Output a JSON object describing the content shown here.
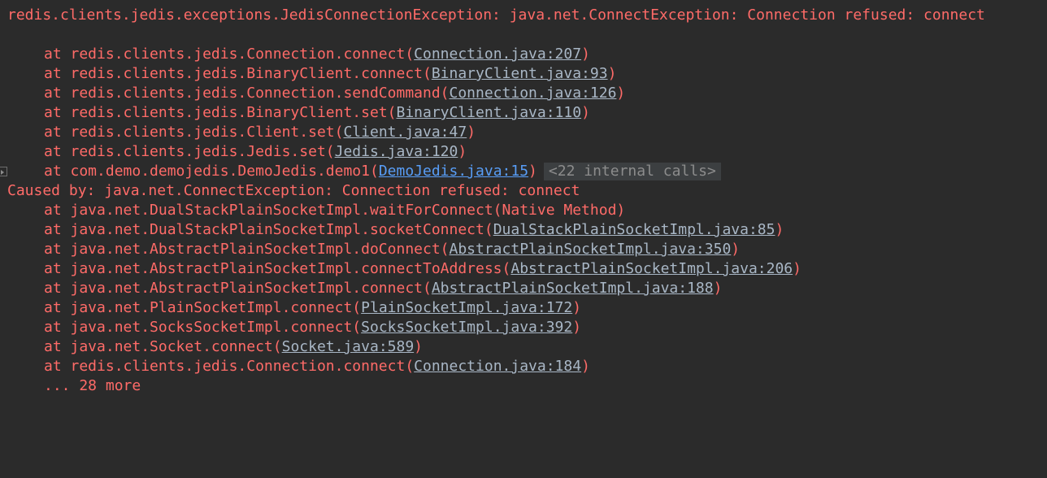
{
  "console": {
    "header": "redis.clients.jedis.exceptions.JedisConnectionException: java.net.ConnectException: Connection refused: connect",
    "frames1": [
      {
        "prefix": "at redis.clients.jedis.Connection.connect(",
        "link": "Connection.java:207",
        "suffix": ")"
      },
      {
        "prefix": "at redis.clients.jedis.BinaryClient.connect(",
        "link": "BinaryClient.java:93",
        "suffix": ")"
      },
      {
        "prefix": "at redis.clients.jedis.Connection.sendCommand(",
        "link": "Connection.java:126",
        "suffix": ")"
      },
      {
        "prefix": "at redis.clients.jedis.BinaryClient.set(",
        "link": "BinaryClient.java:110",
        "suffix": ")"
      },
      {
        "prefix": "at redis.clients.jedis.Client.set(",
        "link": "Client.java:47",
        "suffix": ")"
      },
      {
        "prefix": "at redis.clients.jedis.Jedis.set(",
        "link": "Jedis.java:120",
        "suffix": ")"
      },
      {
        "prefix": "at com.demo.demojedis.DemoJedis.demo1(",
        "link": "DemoJedis.java:15",
        "suffix": ")",
        "fold": "<22 internal calls>"
      }
    ],
    "caused_by": "Caused by: java.net.ConnectException: Connection refused: connect",
    "frames2": [
      {
        "prefix": "at java.net.DualStackPlainSocketImpl.waitForConnect(Native Method)",
        "link": "",
        "suffix": ""
      },
      {
        "prefix": "at java.net.DualStackPlainSocketImpl.socketConnect(",
        "link": "DualStackPlainSocketImpl.java:85",
        "suffix": ")"
      },
      {
        "prefix": "at java.net.AbstractPlainSocketImpl.doConnect(",
        "link": "AbstractPlainSocketImpl.java:350",
        "suffix": ")"
      },
      {
        "prefix": "at java.net.AbstractPlainSocketImpl.connectToAddress(",
        "link": "AbstractPlainSocketImpl.java:206",
        "suffix": ")"
      },
      {
        "prefix": "at java.net.AbstractPlainSocketImpl.connect(",
        "link": "AbstractPlainSocketImpl.java:188",
        "suffix": ")"
      },
      {
        "prefix": "at java.net.PlainSocketImpl.connect(",
        "link": "PlainSocketImpl.java:172",
        "suffix": ")"
      },
      {
        "prefix": "at java.net.SocksSocketImpl.connect(",
        "link": "SocksSocketImpl.java:392",
        "suffix": ")"
      },
      {
        "prefix": "at java.net.Socket.connect(",
        "link": "Socket.java:589",
        "suffix": ")"
      },
      {
        "prefix": "at redis.clients.jedis.Connection.connect(",
        "link": "Connection.java:184",
        "suffix": ")"
      }
    ],
    "more": "... 28 more"
  },
  "colors": {
    "background": "#2b2b2b",
    "error_text": "#ff6b68",
    "link_text": "#a9b7c6",
    "user_link_text": "#589df6",
    "fold_background": "#3c3f41",
    "fold_text": "#8c8c8c"
  },
  "icons": {
    "gutter": "fold-arrow-icon"
  }
}
